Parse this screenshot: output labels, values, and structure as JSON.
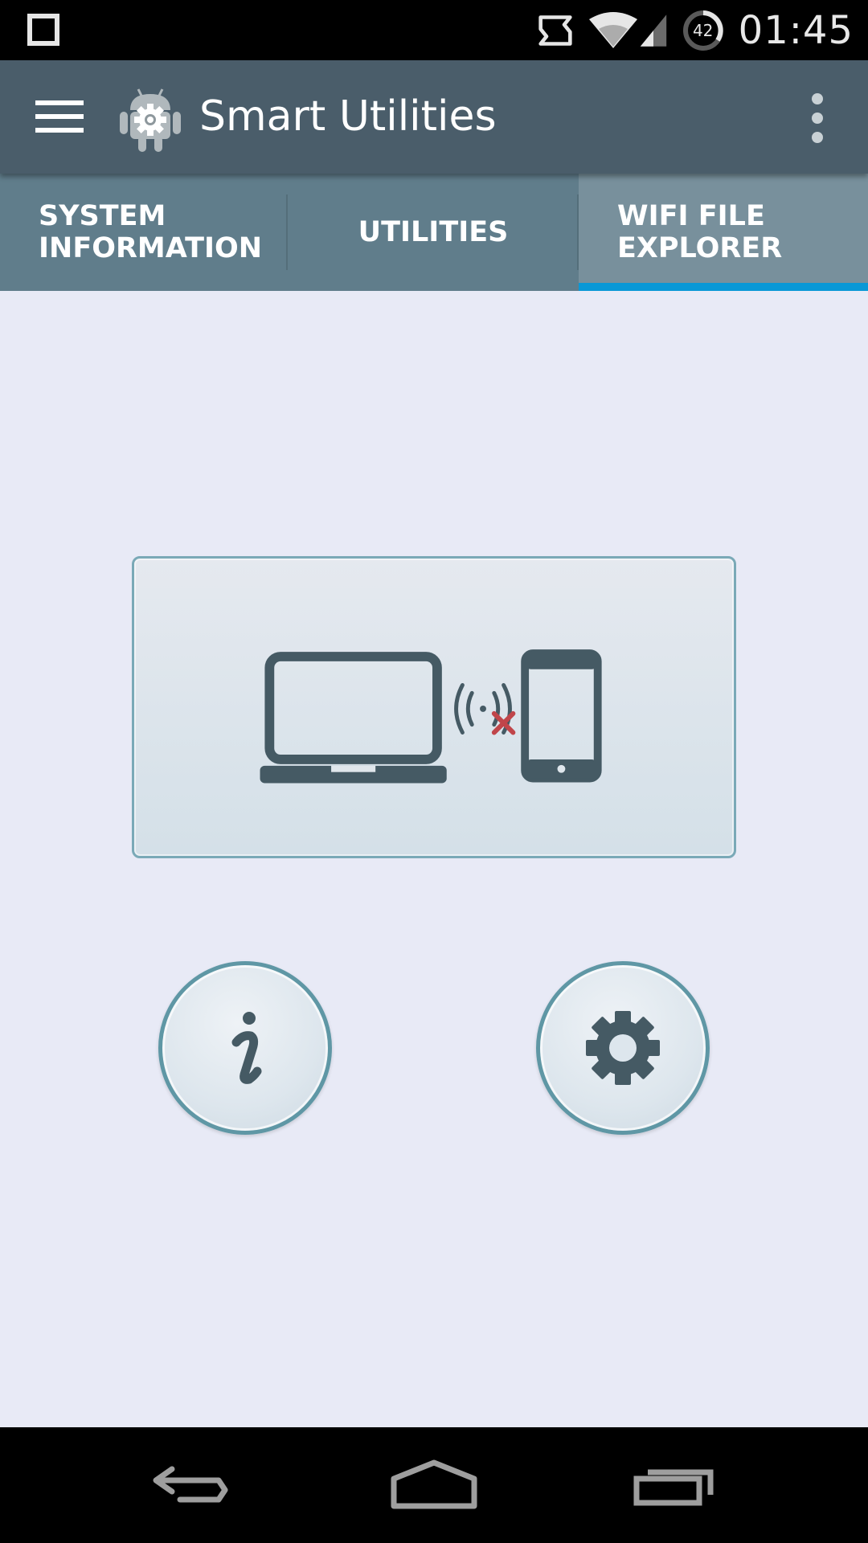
{
  "status_bar": {
    "time": "01:45",
    "battery_level": "42",
    "icons": [
      "square-notification-icon",
      "sync-icon",
      "wifi-icon",
      "cell-signal-icon",
      "battery-icon"
    ]
  },
  "app_bar": {
    "title": "Smart Utilities",
    "icons": [
      "menu-icon",
      "android-gear-logo-icon",
      "overflow-menu-icon"
    ]
  },
  "tabs": [
    {
      "label": "SYSTEM\nINFORMATION",
      "selected": false
    },
    {
      "label": "UTILITIES",
      "selected": false
    },
    {
      "label": "WIFI FILE\nEXPLORER",
      "selected": true
    }
  ],
  "colors": {
    "app_bar": "#4a5d6a",
    "tab_bar": "#607d8b",
    "tab_selected": "#78909c",
    "tab_indicator": "#0a98d6",
    "background": "#e8eaf6",
    "icon_dark": "#455a64",
    "disconnected_x": "#c0454a"
  },
  "main": {
    "connection_card": {
      "icons": [
        "laptop-icon",
        "wireless-signal-icon",
        "disconnected-x-icon",
        "smartphone-icon"
      ]
    },
    "buttons": {
      "info": "info-icon",
      "settings": "gear-icon"
    }
  },
  "nav_bar": {
    "icons": [
      "back-icon",
      "home-icon",
      "recents-icon"
    ]
  }
}
